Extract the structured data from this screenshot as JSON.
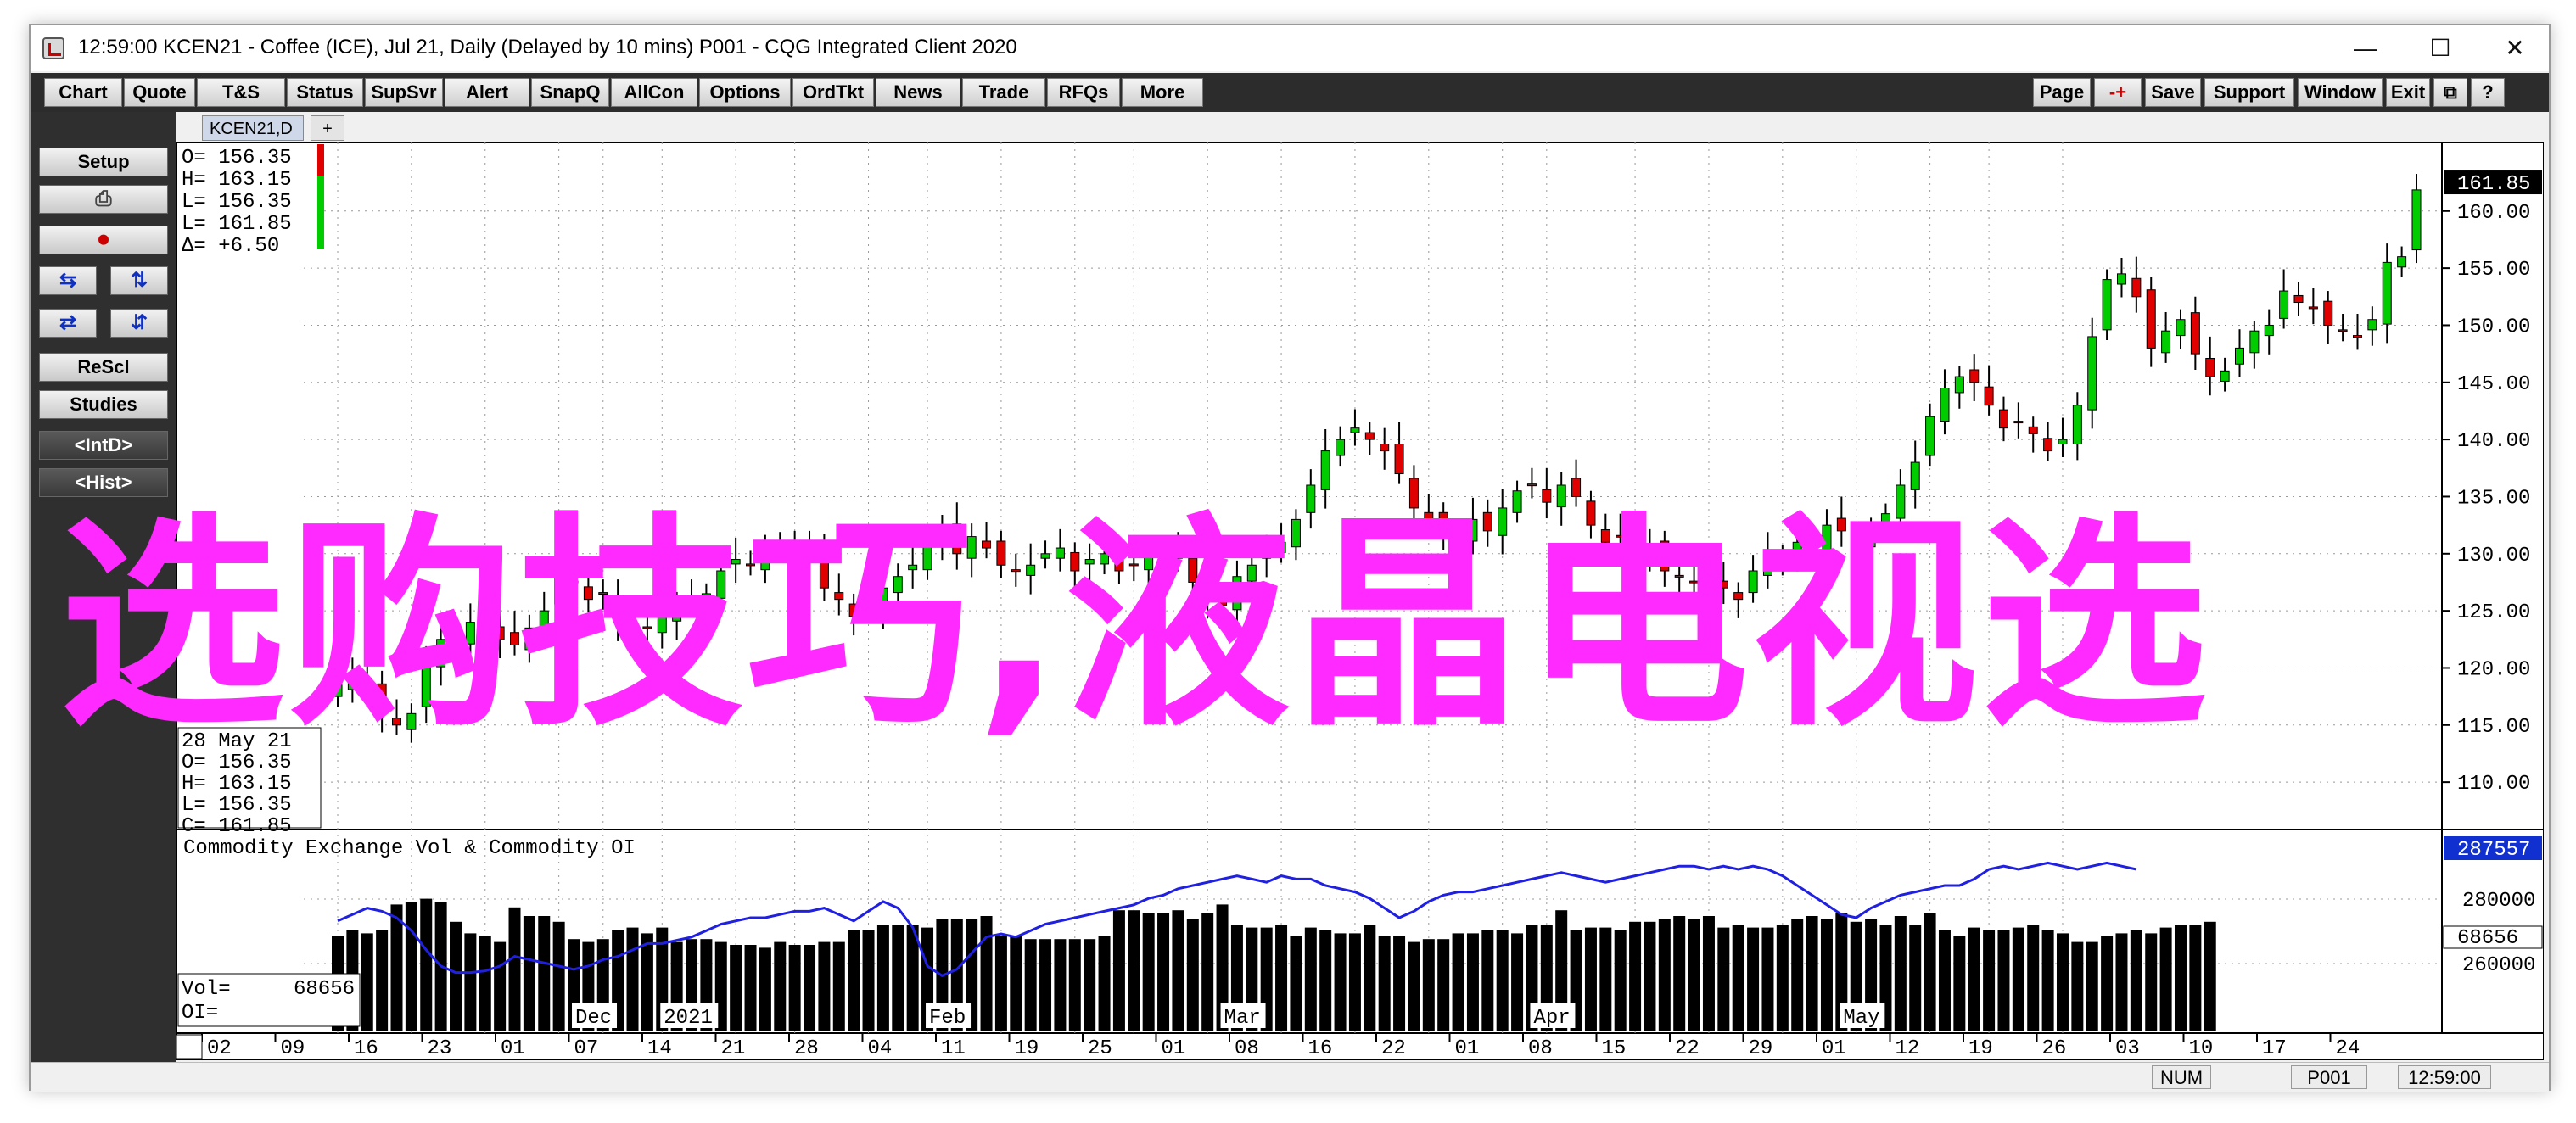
{
  "window": {
    "title": "12:59:00   KCEN21 - Coffee (ICE), Jul 21, Daily (Delayed by 10 mins)   P001 - CQG Integrated Client 2020",
    "controls": [
      "—",
      "☐",
      "✕"
    ]
  },
  "toolbar": {
    "left": [
      "Chart",
      "Quote",
      "T&S",
      "Status",
      "SupSvr",
      "Alert",
      "SnapQ",
      "AllCon",
      "Options",
      "OrdTkt",
      "News",
      "Trade",
      "RFQs",
      "More"
    ],
    "right": [
      "Page",
      "-+",
      "Save",
      "Support",
      "Window",
      "Exit",
      "⧉",
      "?"
    ]
  },
  "leftpanel": {
    "setup": "Setup",
    "print": "⎙",
    "buttons_pairs": [
      [
        "⇆",
        "⇅"
      ],
      [
        "⇄",
        "⇵"
      ]
    ],
    "rescl": "ReScl",
    "studies": "Studies",
    "intd": "<IntD>",
    "hist": "<Hist>"
  },
  "tabs": {
    "active": "KCEN21,D",
    "add": "+"
  },
  "chart": {
    "ohlc_top": [
      "O=  156.35",
      "H=  163.15",
      "L=  156.35",
      "L=  161.85",
      "Δ=   +6.50"
    ],
    "ohlc_bottom": [
      "28 May 21",
      "O=   156.35",
      "H=   163.15",
      "L=   156.35",
      "C=   161.85"
    ],
    "last_price": "161.85",
    "price_ticks": [
      "160.00",
      "155.00",
      "150.00",
      "145.00",
      "140.00",
      "135.00",
      "130.00",
      "125.00",
      "120.00",
      "115.00",
      "110.00"
    ],
    "study_title": "Commodity Exchange Vol & Commodity OI",
    "vol_label": "Vol=",
    "vol_value": "68656",
    "oi_label": "OI=",
    "oi_last": "287557",
    "vol_last": "68656",
    "study_ticks": [
      "280000",
      "260000"
    ],
    "month_labels": [
      "Dec",
      "2021",
      "Feb",
      "Mar",
      "Apr",
      "May"
    ],
    "day_labels": [
      "02",
      "09",
      "16",
      "23",
      "01",
      "07",
      "14",
      "21",
      "28",
      "04",
      "11",
      "19",
      "25",
      "01",
      "08",
      "16",
      "22",
      "01",
      "08",
      "15",
      "22",
      "29",
      "01",
      "12",
      "19",
      "26",
      "03",
      "10",
      "17",
      "24"
    ],
    "colors": {
      "up": "#00cc00",
      "down": "#e00000",
      "oi_line": "#2020e0",
      "grid": "#999999",
      "volume": "#000000"
    }
  },
  "statusbar": {
    "num": "NUM",
    "account": "P001",
    "time": "12:59:00"
  },
  "watermark": "选购技巧,液晶电视选",
  "chart_data": {
    "type": "candlestick",
    "title": "",
    "ylim": [
      106,
      166
    ],
    "x": [
      "2020-12-02",
      "2020-12-03",
      "2020-12-04",
      "2020-12-07",
      "2020-12-08",
      "2020-12-09",
      "2020-12-10",
      "2020-12-11",
      "2020-12-14",
      "2020-12-15",
      "2020-12-16",
      "2020-12-17",
      "2020-12-18",
      "2020-12-21",
      "2020-12-22",
      "2020-12-23",
      "2020-12-24",
      "2020-12-28",
      "2020-12-29",
      "2020-12-30",
      "2020-12-31",
      "2021-01-04",
      "2021-01-05",
      "2021-01-06",
      "2021-01-07",
      "2021-01-08",
      "2021-01-11",
      "2021-01-12",
      "2021-01-13",
      "2021-01-14",
      "2021-01-15",
      "2021-01-19",
      "2021-01-20",
      "2021-01-21",
      "2021-01-22",
      "2021-01-25",
      "2021-01-26",
      "2021-01-27",
      "2021-01-28",
      "2021-01-29",
      "2021-02-01",
      "2021-02-02",
      "2021-02-03",
      "2021-02-04",
      "2021-02-05",
      "2021-02-08",
      "2021-02-09",
      "2021-02-10",
      "2021-02-11",
      "2021-02-12",
      "2021-02-16",
      "2021-02-17",
      "2021-02-18",
      "2021-02-19",
      "2021-02-22",
      "2021-02-23",
      "2021-02-24",
      "2021-02-25",
      "2021-02-26",
      "2021-03-01",
      "2021-03-02",
      "2021-03-03",
      "2021-03-04",
      "2021-03-05",
      "2021-03-08",
      "2021-03-09",
      "2021-03-10",
      "2021-03-11",
      "2021-03-12",
      "2021-03-15",
      "2021-03-16",
      "2021-03-17",
      "2021-03-18",
      "2021-03-19",
      "2021-03-22",
      "2021-03-23",
      "2021-03-24",
      "2021-03-25",
      "2021-03-26",
      "2021-03-29",
      "2021-03-30",
      "2021-03-31",
      "2021-04-01",
      "2021-04-05",
      "2021-04-06",
      "2021-04-07",
      "2021-04-08",
      "2021-04-09",
      "2021-04-12",
      "2021-04-13",
      "2021-04-14",
      "2021-04-15",
      "2021-04-16",
      "2021-04-19",
      "2021-04-20",
      "2021-04-21",
      "2021-04-22",
      "2021-04-23",
      "2021-04-26",
      "2021-04-27",
      "2021-04-28",
      "2021-04-29",
      "2021-04-30",
      "2021-05-03",
      "2021-05-04",
      "2021-05-05",
      "2021-05-06",
      "2021-05-07",
      "2021-05-10",
      "2021-05-11",
      "2021-05-12",
      "2021-05-13",
      "2021-05-14",
      "2021-05-17",
      "2021-05-18",
      "2021-05-19",
      "2021-05-20",
      "2021-05-21",
      "2021-05-24",
      "2021-05-25",
      "2021-05-26",
      "2021-05-27",
      "2021-05-28"
    ],
    "close": [
      118.5,
      119.5,
      118.0,
      116.0,
      115.0,
      116.0,
      120.5,
      122.5,
      121.5,
      124.0,
      124.0,
      122.5,
      122.0,
      123.5,
      125.0,
      128.0,
      127.5,
      126.0,
      126.5,
      124.0,
      123.0,
      123.5,
      124.5,
      125.5,
      126.0,
      126.5,
      128.5,
      129.5,
      129.0,
      130.0,
      131.0,
      130.5,
      130.0,
      127.0,
      126.0,
      124.5,
      125.0,
      127.0,
      128.0,
      129.0,
      131.0,
      132.0,
      130.0,
      131.5,
      130.5,
      129.0,
      128.5,
      129.0,
      130.0,
      130.5,
      128.5,
      129.5,
      130.0,
      128.5,
      129.0,
      130.5,
      129.0,
      130.0,
      127.5,
      126.0,
      125.5,
      128.0,
      129.0,
      130.5,
      131.0,
      133.0,
      136.0,
      139.0,
      140.0,
      141.0,
      140.0,
      139.0,
      137.0,
      134.0,
      133.0,
      132.0,
      131.5,
      133.0,
      132.0,
      134.0,
      135.5,
      136.0,
      134.5,
      136.0,
      135.0,
      132.5,
      131.0,
      131.5,
      130.0,
      130.5,
      128.5,
      128.0,
      127.5,
      128.0,
      127.0,
      126.0,
      128.5,
      130.0,
      129.5,
      131.0,
      130.0,
      132.5,
      132.0,
      131.0,
      131.5,
      133.5,
      136.0,
      138.0,
      142.0,
      144.5,
      145.5,
      145.0,
      143.0,
      141.0,
      141.5,
      140.5,
      139.0,
      140.0,
      143.0,
      149.0,
      154.0,
      154.5,
      152.5,
      148.0,
      149.5,
      150.5,
      147.5,
      145.5,
      146.0,
      148.0,
      149.5,
      150.0,
      153.0,
      152.0,
      151.5,
      150.0,
      149.5,
      149.0,
      150.5,
      155.5,
      156.0,
      161.85
    ],
    "volume_index": "per bar",
    "volume": [
      66,
      70,
      68,
      70,
      88,
      90,
      92,
      90,
      76,
      68,
      66,
      62,
      86,
      80,
      80,
      76,
      64,
      62,
      64,
      70,
      72,
      68,
      72,
      62,
      64,
      64,
      62,
      60,
      60,
      58,
      62,
      60,
      60,
      62,
      62,
      70,
      70,
      74,
      74,
      74,
      72,
      78,
      78,
      78,
      80,
      66,
      66,
      64,
      64,
      64,
      64,
      64,
      66,
      84,
      84,
      82,
      82,
      84,
      78,
      82,
      88,
      74,
      72,
      72,
      74,
      66,
      72,
      70,
      68,
      68,
      74,
      66,
      66,
      62,
      64,
      64,
      68,
      68,
      70,
      70,
      68,
      74,
      74,
      84,
      70,
      72,
      72,
      70,
      76,
      76,
      78,
      80,
      78,
      80,
      72,
      74,
      72,
      72,
      74,
      78,
      80,
      78,
      82,
      76,
      78,
      74,
      80,
      74,
      82,
      70,
      66,
      72,
      70,
      70,
      72,
      74,
      70,
      68,
      62,
      62,
      66,
      68,
      70,
      68,
      72,
      74,
      74,
      76
    ]
  }
}
